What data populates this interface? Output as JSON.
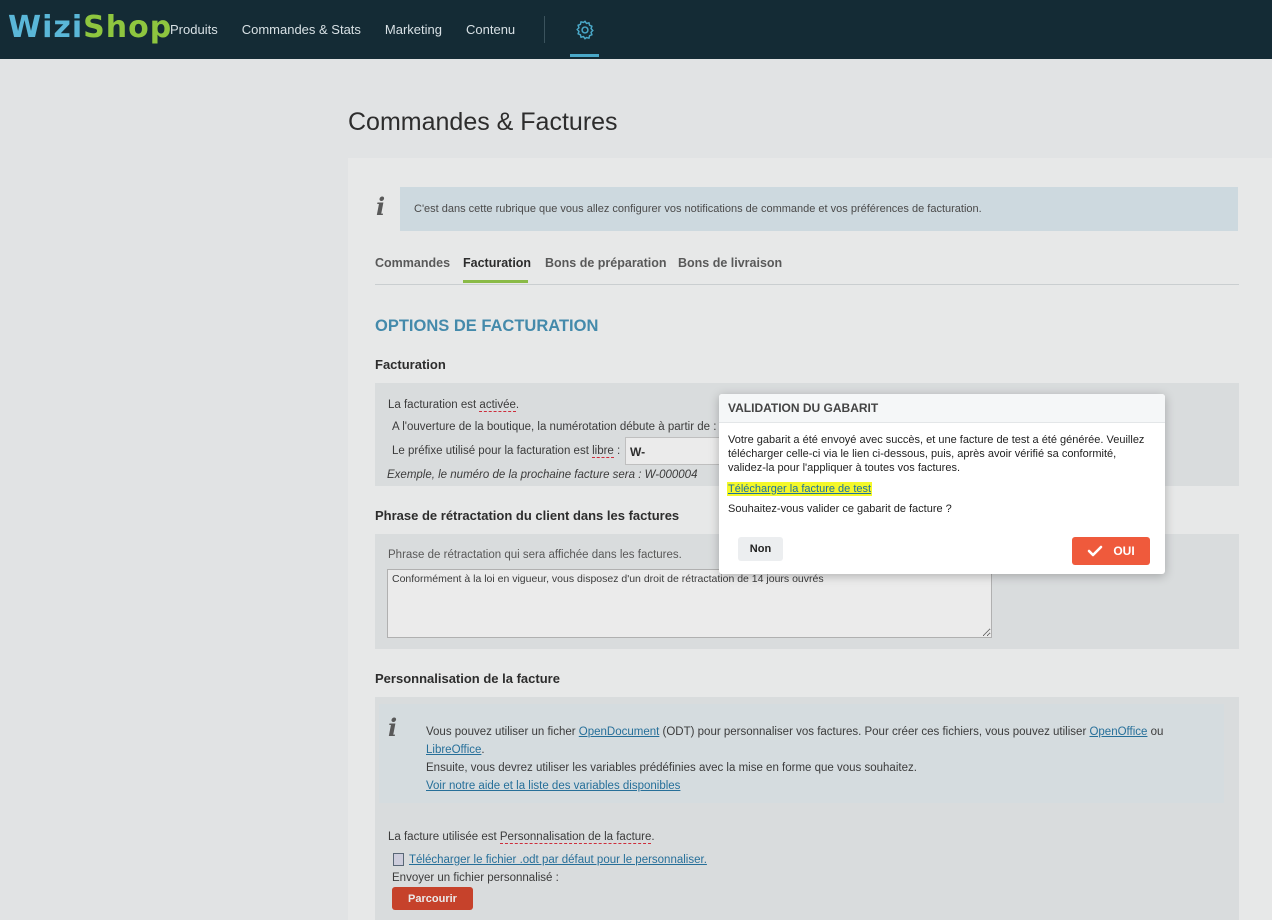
{
  "brand": {
    "part1": "Wizi",
    "part2": "Shop"
  },
  "nav": {
    "items": [
      "Produits",
      "Commandes & Stats",
      "Marketing",
      "Contenu"
    ]
  },
  "icons": {
    "settings": "gear-icon",
    "info": "info-icon",
    "file": "file-icon",
    "check": "check-icon"
  },
  "colors": {
    "topbar": "#142b35",
    "accent_blue": "#3d8fb5",
    "accent_green": "#8ec63f",
    "oui": "#ef5a3c",
    "browse": "#d43b20",
    "highlight": "#f4f829"
  },
  "page": {
    "title": "Commandes & Factures"
  },
  "info": {
    "text": "C'est dans cette rubrique que vous allez configurer vos notifications de commande et vos préférences de facturation."
  },
  "tabs": [
    {
      "label": "Commandes"
    },
    {
      "label": "Facturation",
      "active": true
    },
    {
      "label": "Bons de préparation"
    },
    {
      "label": "Bons de livraison"
    }
  ],
  "section": {
    "title": "OPTIONS DE FACTURATION"
  },
  "facturation": {
    "heading": "Facturation",
    "status_prefix": "La facturation est ",
    "status_value": "activée",
    "status_suffix": ".",
    "numbering": "A l'ouverture de la boutique, la numérotation débute à partir de :",
    "prefix_label_prefix": "Le préfixe utilisé pour la facturation est ",
    "prefix_label_value": "libre",
    "prefix_label_suffix": " :",
    "prefix_value": "W-",
    "example": "Exemple, le numéro de la prochaine facture sera : W-000004"
  },
  "retractation": {
    "heading": "Phrase de rétractation du client dans les factures",
    "label": "Phrase de rétractation qui sera affichée dans les factures.",
    "value": "Conformément à la loi en vigueur, vous disposez d'un droit de rétractation de 14 jours ouvrés"
  },
  "personnalisation": {
    "heading": "Personnalisation de la facture",
    "info_p1": "Vous pouvez utiliser un ficher ",
    "link_opendocument": "OpenDocument",
    "info_p2": " (ODT) pour personnaliser vos factures. Pour créer ces fichiers, vous pouvez utiliser ",
    "link_openoffice": "OpenOffice",
    "info_p3": " ou",
    "link_libreoffice": "LibreOffice",
    "info_p4": ".",
    "info_line2": "Ensuite, vous devrez utiliser les variables prédéfinies avec la mise en forme que vous souhaitez.",
    "link_help": "Voir notre aide et la liste des variables disponibles",
    "used_prefix": "La facture utilisée est ",
    "used_value": "Personnalisation de la facture",
    "used_suffix": ".",
    "download_link": "Télécharger le fichier .odt par défaut pour le personnaliser.",
    "upload_label": "Envoyer un fichier personnalisé :",
    "browse_button": "Parcourir"
  },
  "modal": {
    "title": "VALIDATION DU GABARIT",
    "body": "Votre gabarit a été envoyé avec succès, et une facture de test a été générée. Veuillez télécharger celle-ci via le lien ci-dessous, puis, après avoir vérifié sa conformité, validez-la pour l'appliquer à toutes vos factures.",
    "link": "Télécharger la facture de test",
    "question": "Souhaitez-vous valider ce gabarit de facture ?",
    "no": "Non",
    "yes": "OUI"
  }
}
